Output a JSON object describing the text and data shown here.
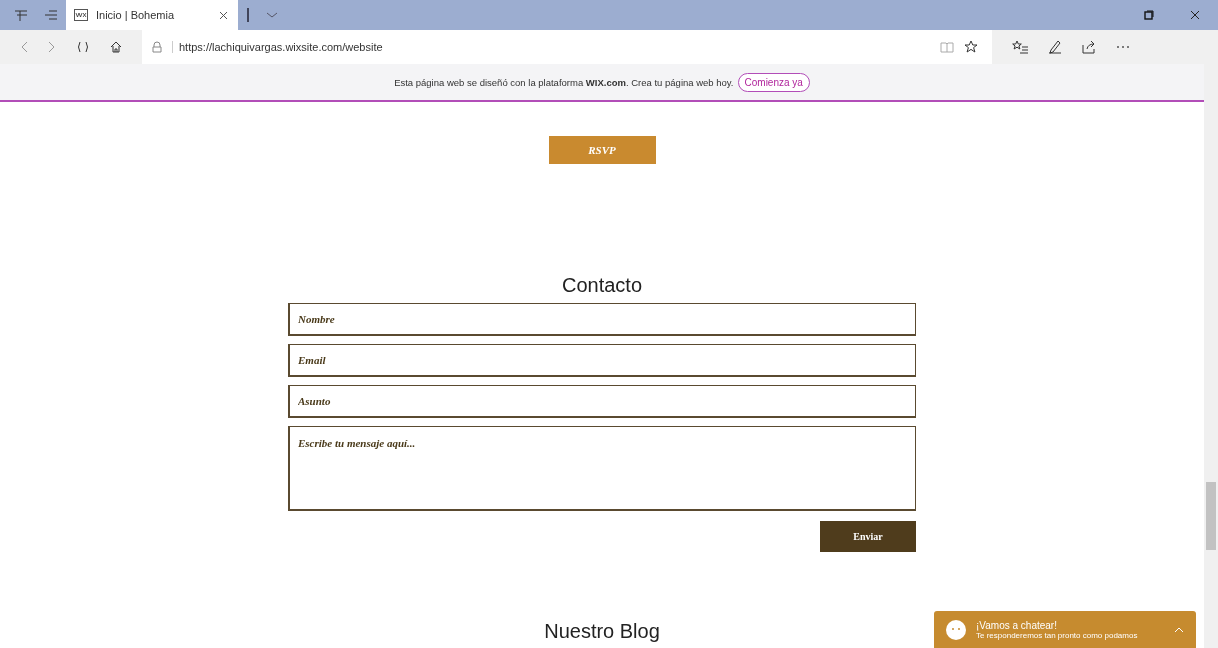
{
  "browser": {
    "tab": {
      "title": "Inicio | Bohemia",
      "selected": true
    },
    "url": "https://lachiquivargas.wixsite.com/website"
  },
  "banner": {
    "text": "Esta página web se diseñó con la plataforma **WIX.com**. Crea tu página web hoy.",
    "button": "Comienza ya"
  },
  "rsvp_button": "RSVP",
  "contact": {
    "title": "Contacto",
    "fields": [
      {
        "kind": "input",
        "placeholder": "Nombre"
      },
      {
        "kind": "input",
        "placeholder": "Email"
      },
      {
        "kind": "input",
        "placeholder": "Asunto"
      },
      {
        "kind": "textarea",
        "placeholder": "Escribe tu mensaje aquí..."
      }
    ],
    "submit": "Enviar"
  },
  "blog_title": "Nuestro Blog",
  "chat": {
    "title": "¡Vamos a chatear!",
    "subtitle": "Te responderemos tan pronto como podamos"
  }
}
